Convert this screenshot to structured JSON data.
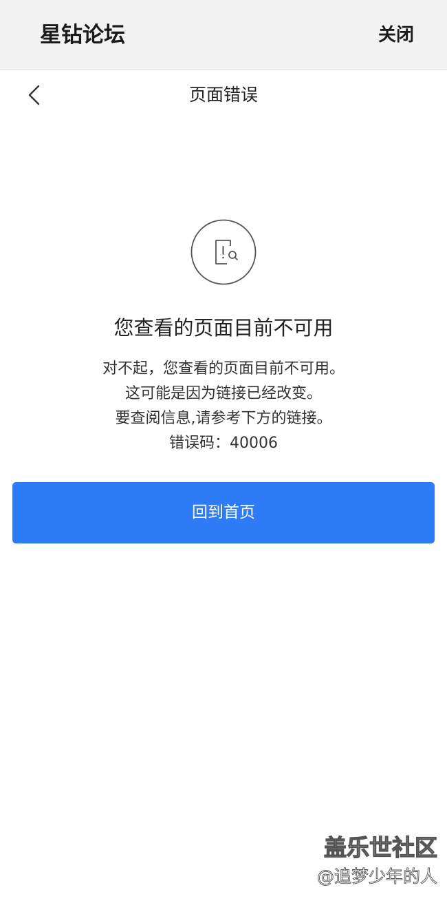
{
  "app_bar": {
    "title": "星钻论坛",
    "close_label": "关闭"
  },
  "nav": {
    "back_icon": "chevron-left-icon",
    "title": "页面错误"
  },
  "error": {
    "icon": "page-search-error-icon",
    "heading": "您查看的页面目前不可用",
    "lines": [
      "对不起，您查看的页面目前不可用。",
      "这可能是因为链接已经改变。",
      "要查阅信息,请参考下方的链接。",
      "错误码：40006"
    ]
  },
  "actions": {
    "home_label": "回到首页"
  },
  "watermark": {
    "line1": "盖乐世社区",
    "line2": "@追梦少年的人"
  },
  "colors": {
    "primary": "#2d7cf5",
    "app_bar_bg": "#f2f2f2",
    "text": "#222222"
  }
}
